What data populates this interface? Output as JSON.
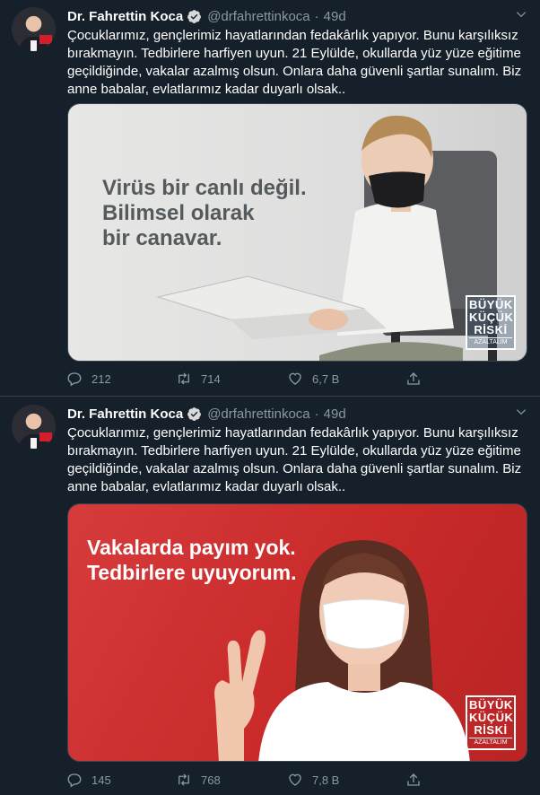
{
  "tweets": [
    {
      "author": {
        "name": "Dr. Fahrettin Koca",
        "handle": "@drfahrettinkoca",
        "avatar_icon": "profile-photo"
      },
      "separator": "·",
      "time": "49d",
      "text": "Çocuklarımız, gençlerimiz hayatlarından fedakârlık yapıyor. Bunu karşılıksız bırakmayın. Tedbirlere harfiyen uyun. 21 Eylülde, okullarda yüz yüze eğitime geçildiğinde, vakalar azalmış olsun. Onlara daha güvenli şartlar sunalım. Biz anne babalar, evlatlarımız kadar duyarlı olsak..",
      "image": {
        "caption_lines": [
          "Virüs bir canlı değil.",
          "Bilimsel olarak",
          "bir canavar."
        ],
        "brand_lines": [
          "BÜYÜK",
          "KÜÇÜK",
          "RİSKİ"
        ],
        "brand_sub": "AZALTALIM"
      },
      "stats": {
        "replies": "212",
        "retweets": "714",
        "likes": "6,7 B"
      }
    },
    {
      "author": {
        "name": "Dr. Fahrettin Koca",
        "handle": "@drfahrettinkoca",
        "avatar_icon": "profile-photo"
      },
      "separator": "·",
      "time": "49d",
      "text": "Çocuklarımız, gençlerimiz hayatlarından fedakârlık yapıyor. Bunu karşılıksız bırakmayın. Tedbirlere harfiyen uyun. 21 Eylülde, okullarda yüz yüze eğitime geçildiğinde, vakalar azalmış olsun. Onlara daha güvenli şartlar sunalım. Biz anne babalar, evlatlarımız kadar duyarlı olsak..",
      "image": {
        "caption_lines": [
          "Vakalarda payım yok.",
          "Tedbirlere uyuyorum."
        ],
        "brand_lines": [
          "BÜYÜK",
          "KÜÇÜK",
          "RİSKİ"
        ],
        "brand_sub": "AZALTALIM"
      },
      "stats": {
        "replies": "145",
        "retweets": "768",
        "likes": "7,8 B"
      }
    }
  ],
  "icons": {
    "verified": "verified-badge-icon",
    "menu": "chevron-down-icon",
    "reply": "reply-icon",
    "retweet": "retweet-icon",
    "like": "heart-icon",
    "share": "share-icon"
  },
  "colors": {
    "background": "#15202b",
    "divider": "#38444d",
    "muted": "#8899a6",
    "text": "#ffffff",
    "verified": "#d9d9d9"
  }
}
